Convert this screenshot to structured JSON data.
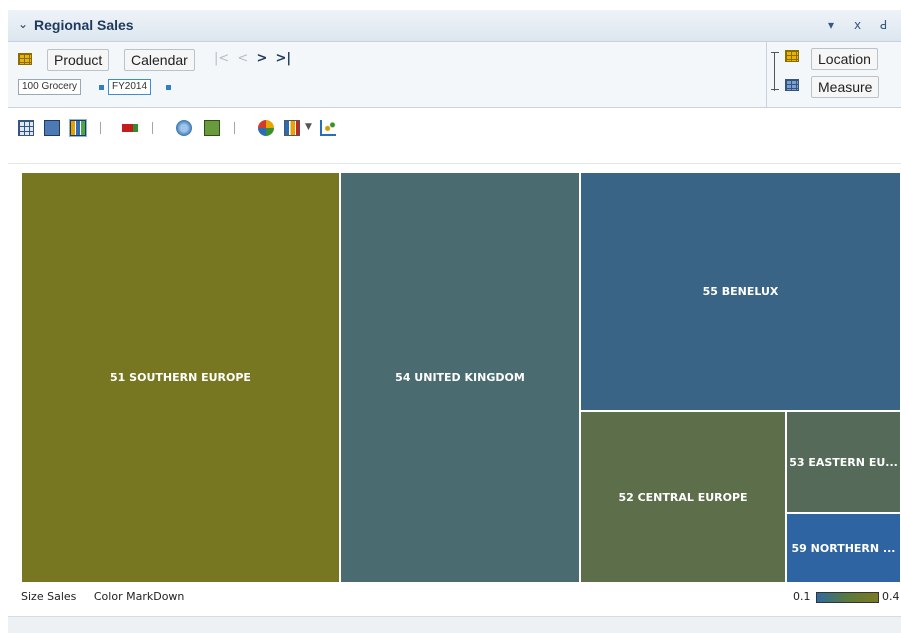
{
  "panel": {
    "title": "Regional Sales",
    "icons": [
      "chevron-down-icon",
      "dropdown-triangle-icon",
      "minimize-icon",
      "maximize-icon"
    ]
  },
  "pivot": {
    "row_buttons": [
      "Product",
      "Calendar"
    ],
    "nav": [
      "|<",
      "<",
      ">",
      ">|"
    ],
    "filters": [
      "100 Grocery",
      "FY2014"
    ],
    "right_buttons": [
      "Location",
      "Measure"
    ]
  },
  "treemap": {
    "tiles": [
      {
        "label": "51 SOUTHERN EUROPE",
        "color": "#777722"
      },
      {
        "label": "54 UNITED KINGDOM",
        "color": "#4a6b6f"
      },
      {
        "label": "55 BENELUX",
        "color": "#3a6485"
      },
      {
        "label": "52 CENTRAL EUROPE",
        "color": "#5d6e4a"
      },
      {
        "label": "53 EASTERN EU...",
        "color": "#556a58"
      },
      {
        "label": "59 NORTHERN ...",
        "color": "#2f64a2"
      }
    ]
  },
  "footer": {
    "size_label": "Size",
    "size_value": "Sales",
    "color_label": "Color",
    "color_value": "MarkDown",
    "scale_min": "0.1",
    "scale_max": "0.4"
  }
}
